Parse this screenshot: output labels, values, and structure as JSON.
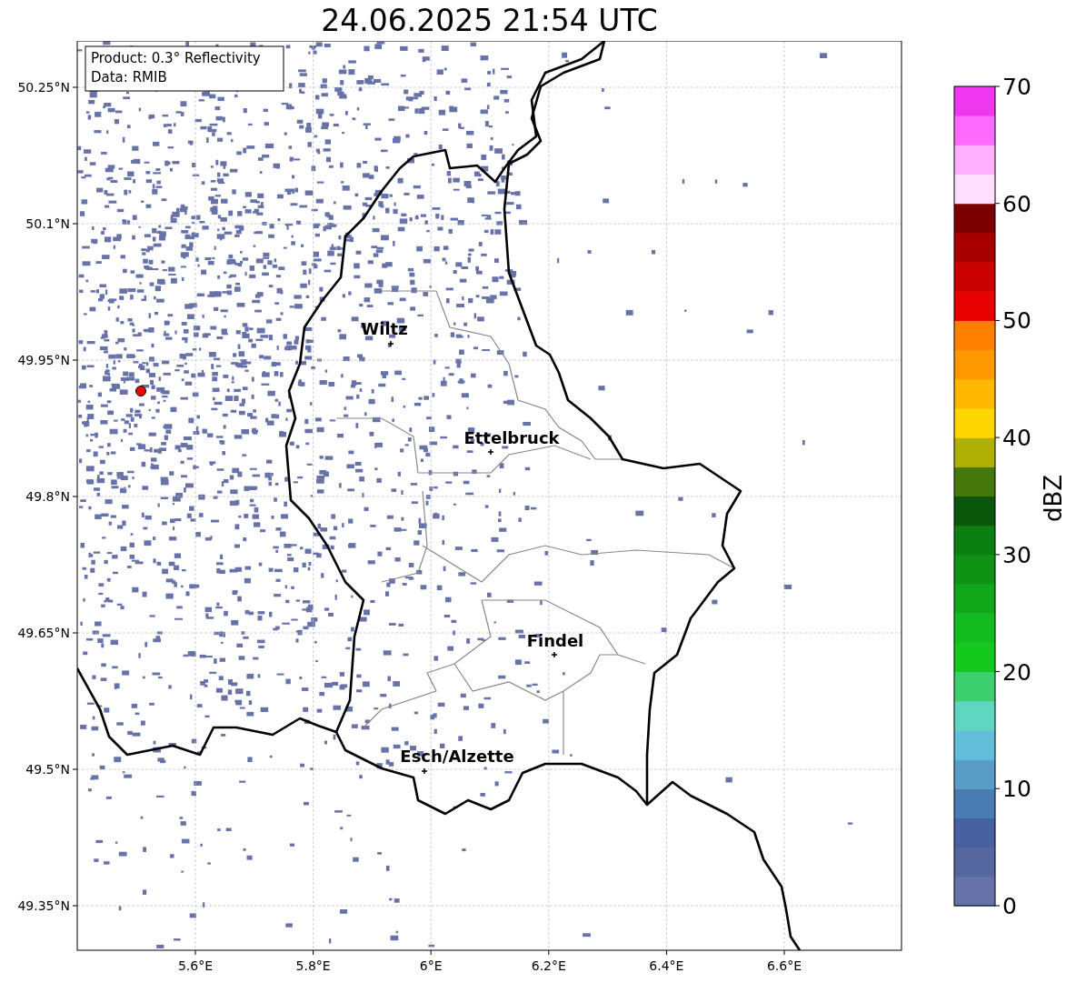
{
  "title": "24.06.2025 21:54 UTC",
  "info_box": [
    "Product: 0.3° Reflectivity",
    "Data: RMIB"
  ],
  "map": {
    "yticks": [
      "50.25°N",
      "50.1°N",
      "49.95°N",
      "49.8°N",
      "49.65°N",
      "49.5°N",
      "49.35°N"
    ],
    "xticks": [
      "5.6°E",
      "5.8°E",
      "6°E",
      "6.2°E",
      "6.4°E",
      "6.6°E"
    ],
    "cities": [
      {
        "name": "Wiltz"
      },
      {
        "name": "Ettelbruck"
      },
      {
        "name": "Findel"
      },
      {
        "name": "Esch/Alzette"
      }
    ]
  },
  "colorbar": {
    "label": "dBZ",
    "ticks": [
      "70",
      "60",
      "50",
      "40",
      "30",
      "20",
      "10",
      "0"
    ],
    "bins": [
      {
        "color": "#6672a8"
      },
      {
        "color": "#5667a0"
      },
      {
        "color": "#4660a0"
      },
      {
        "color": "#4a7cb3"
      },
      {
        "color": "#5a9ec7"
      },
      {
        "color": "#63bfd9"
      },
      {
        "color": "#60d6c0"
      },
      {
        "color": "#3ecf6e"
      },
      {
        "color": "#14c81e"
      },
      {
        "color": "#12bb1e"
      },
      {
        "color": "#10a818"
      },
      {
        "color": "#0f9314"
      },
      {
        "color": "#0c7f12"
      },
      {
        "color": "#0a560a"
      },
      {
        "color": "#45770b"
      },
      {
        "color": "#afb005"
      },
      {
        "color": "#ffd700"
      },
      {
        "color": "#ffb700"
      },
      {
        "color": "#ff9800"
      },
      {
        "color": "#ff7f00"
      },
      {
        "color": "#e60000"
      },
      {
        "color": "#c80000"
      },
      {
        "color": "#a80000"
      },
      {
        "color": "#7d0000"
      },
      {
        "color": "#ffdeff"
      },
      {
        "color": "#ffb0ff"
      },
      {
        "color": "#ff6aff"
      },
      {
        "color": "#ee37ee"
      }
    ]
  }
}
